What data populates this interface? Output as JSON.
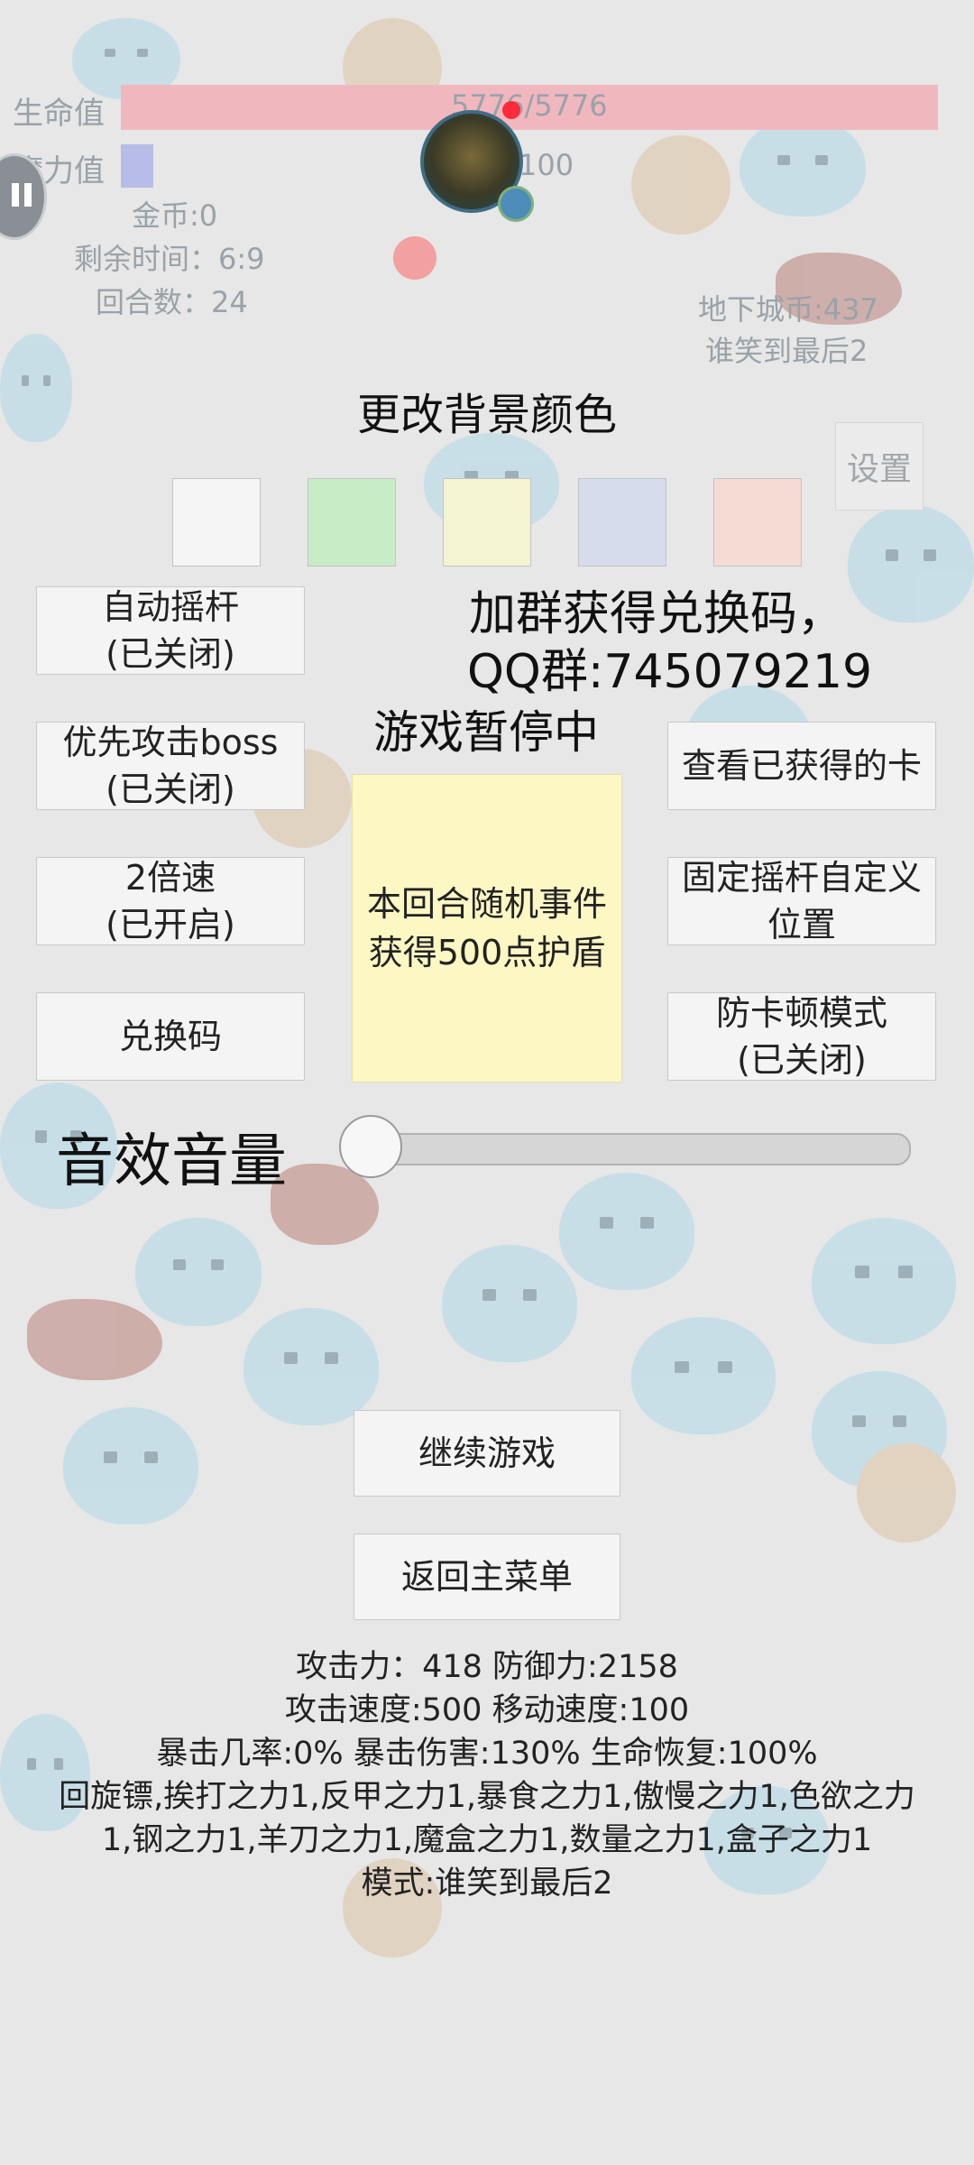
{
  "hud": {
    "hp_label": "生命值",
    "hp_value": "5776/5776",
    "mp_label": "魔力值",
    "mp_value": "100",
    "gold": "金币:0",
    "time_left": "剩余时间：6:9",
    "rounds": "回合数：24",
    "dungeon_coins": "地下城币:437",
    "mode_tag": "谁笑到最后2",
    "settings": "设置"
  },
  "panel": {
    "bg_color_title": "更改背景颜色",
    "swatches": [
      "#f5f5f5",
      "#c8ecc6",
      "#f4f3d2",
      "#d6dcec",
      "#f4dcd5"
    ],
    "group_line1": "加群获得兑换码，",
    "group_line2": "QQ群:745079219",
    "paused": "游戏暂停中",
    "event_line1": "本回合随机事件",
    "event_line2": "获得500点护盾",
    "volume_label": "音效音量",
    "volume_level": 0.0,
    "left_buttons": [
      {
        "line1": "自动摇杆",
        "line2": "(已关闭)"
      },
      {
        "line1": "优先攻击boss",
        "line2": "(已关闭)"
      },
      {
        "line1": "2倍速",
        "line2": "(已开启)"
      },
      {
        "line1": "兑换码",
        "line2": ""
      }
    ],
    "right_buttons": [
      {
        "line1": "查看已获得的卡",
        "line2": ""
      },
      {
        "line1": "固定摇杆自定义",
        "line2": "位置"
      },
      {
        "line1": "防卡顿模式",
        "line2": "(已关闭)"
      }
    ],
    "continue": "继续游戏",
    "main_menu": "返回主菜单"
  },
  "stats": {
    "line1": "攻击力：418 防御力:2158",
    "line2": "攻击速度:500 移动速度:100",
    "line3": "暴击几率:0% 暴击伤害:130% 生命恢复:100%",
    "line4": "回旋镖,挨打之力1,反甲之力1,暴食之力1,傲慢之力1,色欲之力",
    "line5": "1,钢之力1,羊刀之力1,魔盒之力1,数量之力1,盒子之力1",
    "line6": "模式:谁笑到最后2"
  }
}
